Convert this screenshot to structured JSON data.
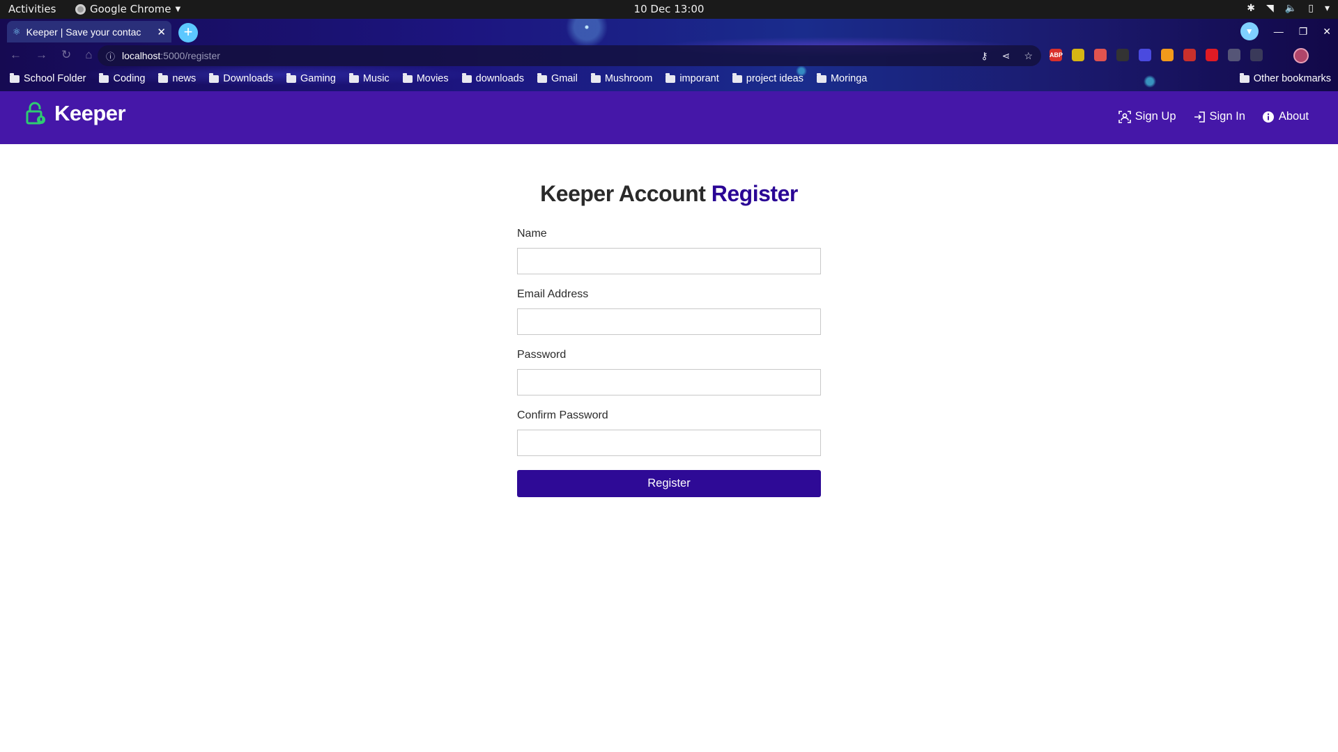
{
  "system": {
    "activities": "Activities",
    "app_name": "Google Chrome",
    "clock": "10 Dec  13:00"
  },
  "browser": {
    "tab_title": "Keeper | Save your contac",
    "url_host": "localhost",
    "url_path": ":5000/register",
    "bookmarks": [
      {
        "label": "School Folder"
      },
      {
        "label": "Coding"
      },
      {
        "label": "news"
      },
      {
        "label": "Downloads"
      },
      {
        "label": "Gaming"
      },
      {
        "label": "Music"
      },
      {
        "label": "Movies"
      },
      {
        "label": "downloads"
      },
      {
        "label": "Gmail"
      },
      {
        "label": "Mushroom"
      },
      {
        "label": "imporant"
      },
      {
        "label": "project ideas"
      },
      {
        "label": "Moringa"
      }
    ],
    "other_bookmarks": "Other bookmarks",
    "extensions": [
      {
        "label": "ABP",
        "color": "#d9302b"
      },
      {
        "label": "",
        "color": "#d6b514"
      },
      {
        "label": "",
        "color": "#e0534f"
      },
      {
        "label": "",
        "color": "#333333"
      },
      {
        "label": "",
        "color": "#4a4adf"
      },
      {
        "label": "",
        "color": "#f29a1b"
      },
      {
        "label": "",
        "color": "#c9302c"
      },
      {
        "label": "",
        "color": "#e01b24"
      },
      {
        "label": "",
        "color": "#555577"
      },
      {
        "label": "",
        "color": "#3a3a5a"
      }
    ]
  },
  "navbar": {
    "brand": "Keeper",
    "brand_color": "#2ecc71",
    "links": [
      {
        "label": "Sign Up",
        "icon": "user-scan-icon"
      },
      {
        "label": "Sign In",
        "icon": "sign-in-icon"
      },
      {
        "label": "About",
        "icon": "info-icon"
      }
    ]
  },
  "page": {
    "heading_prefix": "Keeper Account",
    "heading_accent": "Register",
    "fields": [
      {
        "label": "Name",
        "value": "",
        "placeholder": ""
      },
      {
        "label": "Email Address",
        "value": "",
        "placeholder": ""
      },
      {
        "label": "Password",
        "value": "",
        "placeholder": ""
      },
      {
        "label": "Confirm Password",
        "value": "",
        "placeholder": ""
      }
    ],
    "submit_label": "Register",
    "accent_color": "#2e0a96"
  }
}
